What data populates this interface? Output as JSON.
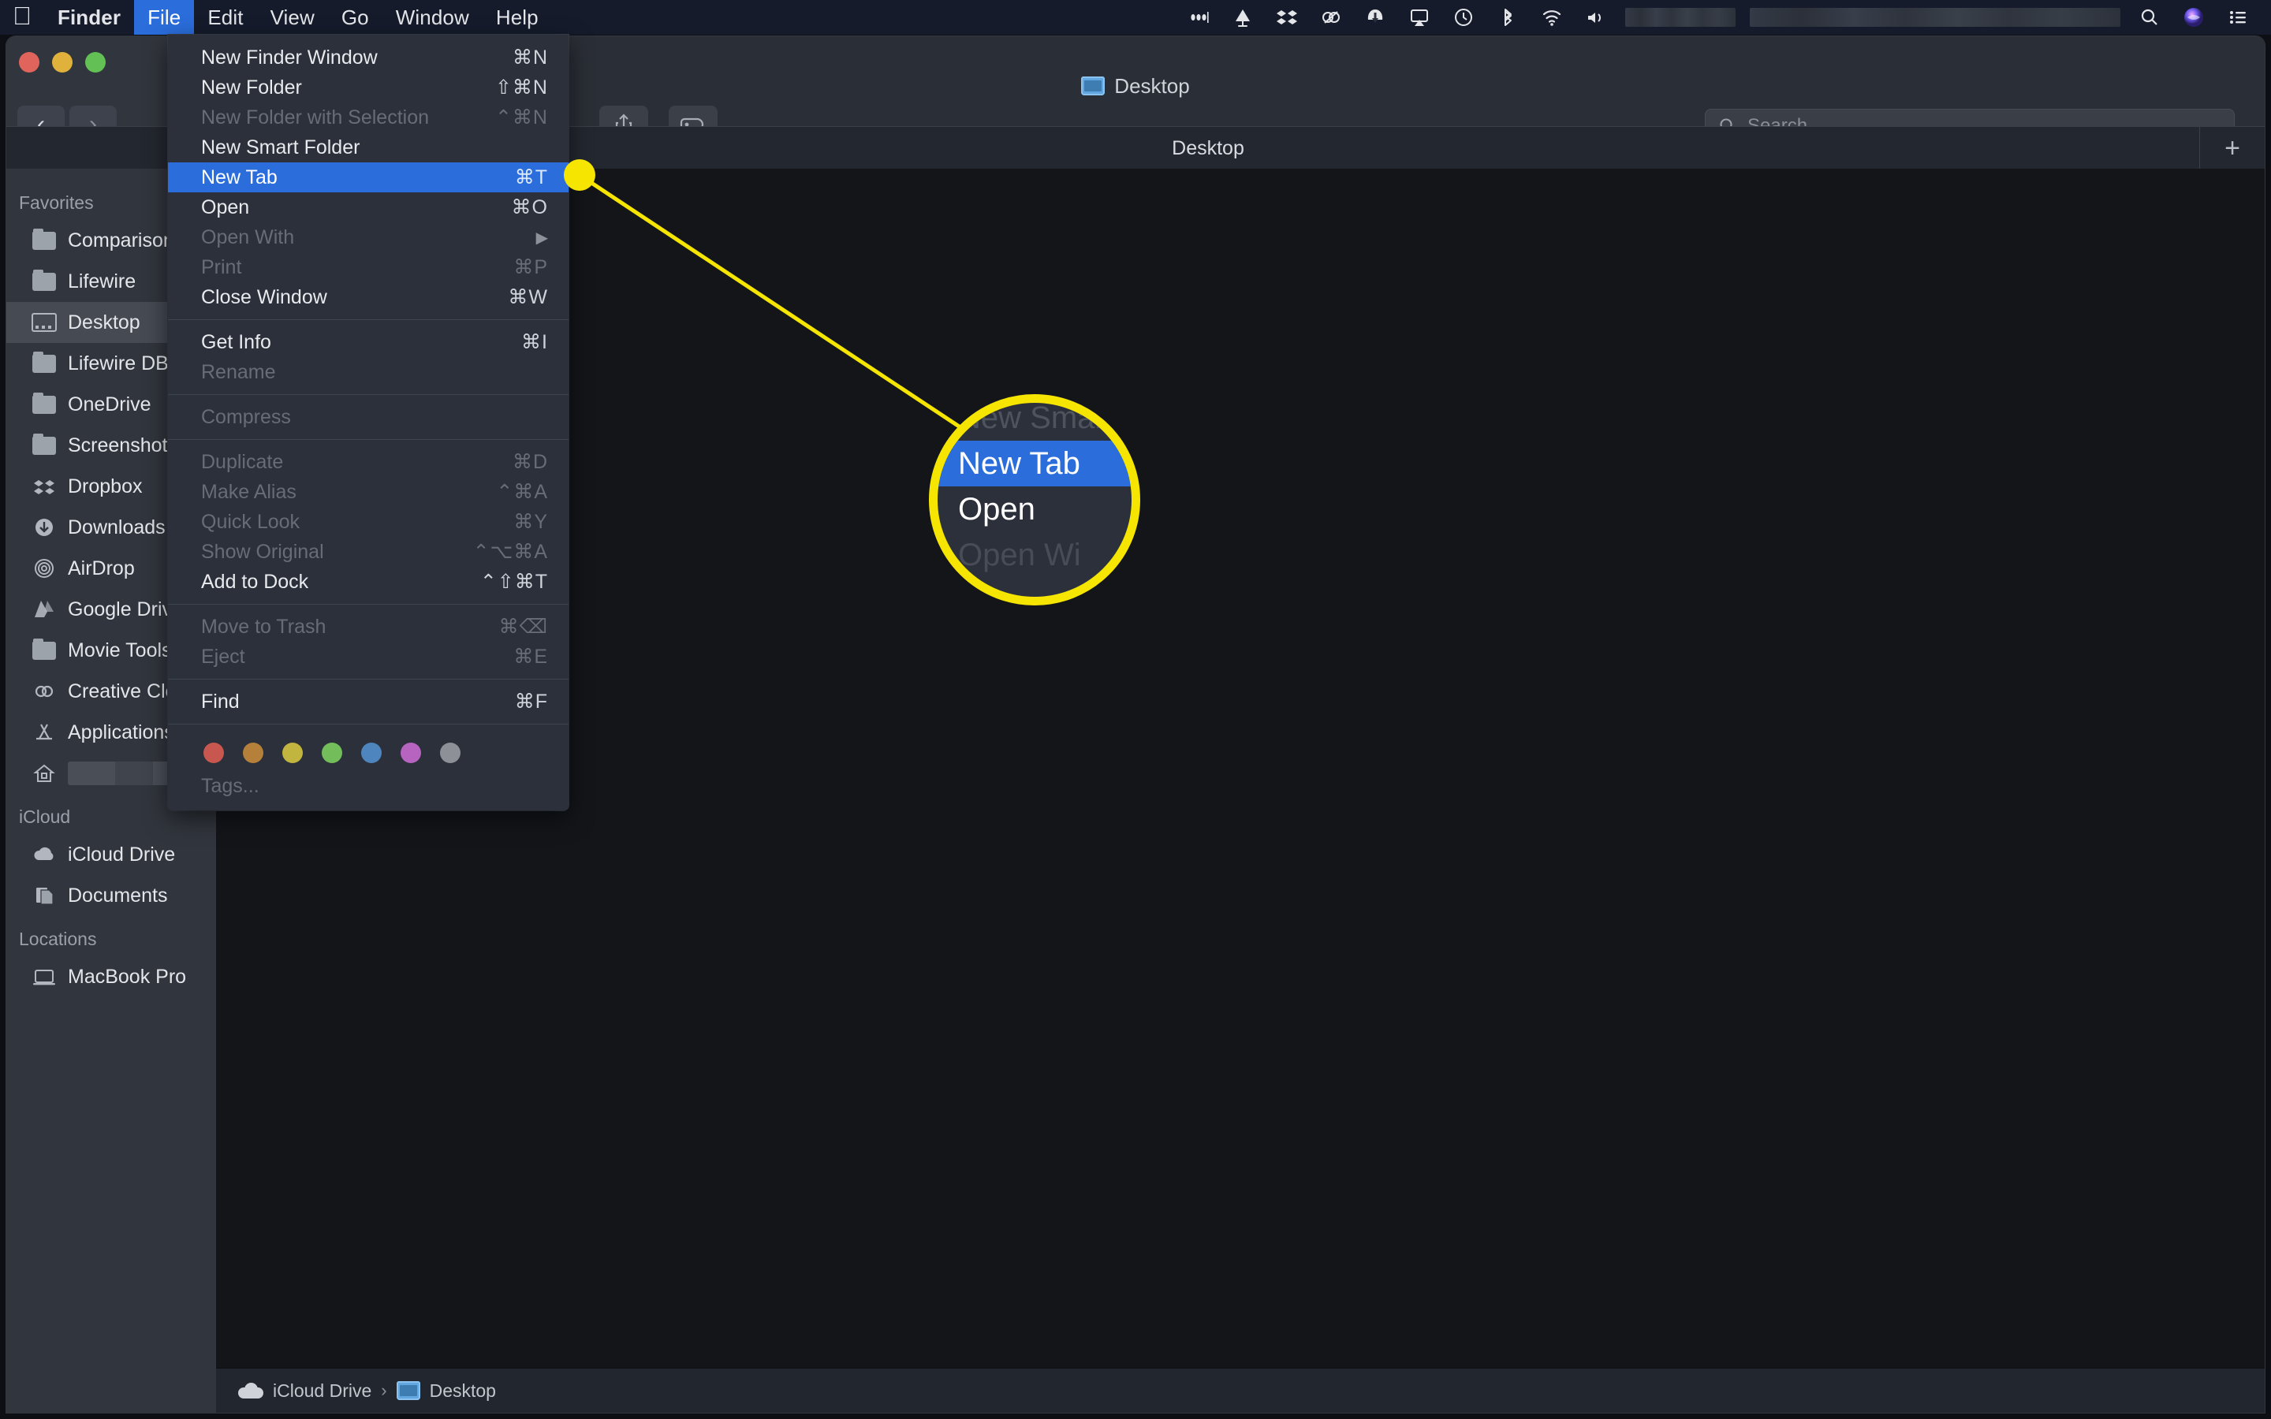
{
  "menubar": {
    "apple_icon": "apple-logo-icon",
    "items": [
      {
        "label": "Finder",
        "bold": true,
        "active": false
      },
      {
        "label": "File",
        "bold": false,
        "active": true
      },
      {
        "label": "Edit",
        "bold": false,
        "active": false
      },
      {
        "label": "View",
        "bold": false,
        "active": false
      },
      {
        "label": "Go",
        "bold": false,
        "active": false
      },
      {
        "label": "Window",
        "bold": false,
        "active": false
      },
      {
        "label": "Help",
        "bold": false,
        "active": false
      }
    ],
    "status_icons": [
      "ellipsis-icon",
      "bell-lamp-icon",
      "dropbox-icon",
      "creative-cloud-icon",
      "onedrive-cloud-icon",
      "airplay-icon",
      "time-machine-icon",
      "bluetooth-icon",
      "wifi-icon",
      "volume-icon"
    ],
    "redacted_widths": [
      140,
      470
    ],
    "trailing_icons": [
      "search-icon",
      "siri-icon",
      "control-center-icon"
    ]
  },
  "window": {
    "title": "Desktop",
    "title_folder_icon": "blue-folder-icon",
    "traffic_lights": [
      "close-button",
      "minimize-button",
      "maximize-button"
    ],
    "nav": {
      "back": "back-chevron-icon",
      "forward": "forward-chevron-icon"
    },
    "toolbar_buttons": [
      "share-icon",
      "tags-icon"
    ],
    "search": {
      "placeholder": "Search",
      "value": "",
      "icon": "search-icon"
    },
    "tab": {
      "label": "Desktop",
      "add_label": "+"
    },
    "pathbar": {
      "segments": [
        {
          "label": "iCloud Drive",
          "icon": "cloud-icon"
        },
        {
          "label": "Desktop",
          "icon": "blue-folder-icon"
        }
      ],
      "separator": "›"
    }
  },
  "sidebar": {
    "groups": [
      {
        "title": "Favorites",
        "items": [
          {
            "label": "Comparison",
            "icon": "folder-icon",
            "selected": false,
            "redacted": false
          },
          {
            "label": "Lifewire",
            "icon": "folder-icon",
            "selected": false,
            "redacted": false
          },
          {
            "label": "Desktop",
            "icon": "desktop-icon",
            "selected": true,
            "redacted": false
          },
          {
            "label": "Lifewire DB",
            "icon": "folder-icon",
            "selected": false,
            "redacted": false
          },
          {
            "label": "OneDrive",
            "icon": "folder-icon",
            "selected": false,
            "redacted": false
          },
          {
            "label": "Screenshots",
            "icon": "folder-icon",
            "selected": false,
            "redacted": false
          },
          {
            "label": "Dropbox",
            "icon": "dropbox-icon",
            "selected": false,
            "redacted": false
          },
          {
            "label": "Downloads",
            "icon": "downloads-icon",
            "selected": false,
            "redacted": false
          },
          {
            "label": "AirDrop",
            "icon": "airdrop-icon",
            "selected": false,
            "redacted": false
          },
          {
            "label": "Google Drive",
            "icon": "google-drive-icon",
            "selected": false,
            "redacted": false
          },
          {
            "label": "Movie Tools",
            "icon": "folder-icon",
            "selected": false,
            "redacted": false
          },
          {
            "label": "Creative Cloud",
            "icon": "creative-cloud-icon",
            "selected": false,
            "redacted": false
          },
          {
            "label": "Applications",
            "icon": "applications-icon",
            "selected": false,
            "redacted": false
          },
          {
            "label": "",
            "icon": "home-icon",
            "selected": false,
            "redacted": true
          }
        ]
      },
      {
        "title": "iCloud",
        "items": [
          {
            "label": "iCloud Drive",
            "icon": "cloud-icon",
            "selected": false,
            "redacted": false
          },
          {
            "label": "Documents",
            "icon": "documents-icon",
            "selected": false,
            "redacted": false
          }
        ]
      },
      {
        "title": "Locations",
        "items": [
          {
            "label": "MacBook Pro",
            "icon": "laptop-icon",
            "selected": false,
            "redacted": false
          }
        ]
      }
    ]
  },
  "file_menu": {
    "sections": [
      {
        "items": [
          {
            "label": "New Finder Window",
            "shortcut": "⌘N",
            "state": "normal"
          },
          {
            "label": "New Folder",
            "shortcut": "⇧⌘N",
            "state": "normal"
          },
          {
            "label": "New Folder with Selection",
            "shortcut": "⌃⌘N",
            "state": "disabled"
          },
          {
            "label": "New Smart Folder",
            "shortcut": "",
            "state": "normal"
          },
          {
            "label": "New Tab",
            "shortcut": "⌘T",
            "state": "highlighted"
          },
          {
            "label": "Open",
            "shortcut": "⌘O",
            "state": "normal"
          },
          {
            "label": "Open With",
            "shortcut": "▶",
            "state": "disabled",
            "submenu": true
          },
          {
            "label": "Print",
            "shortcut": "⌘P",
            "state": "disabled"
          },
          {
            "label": "Close Window",
            "shortcut": "⌘W",
            "state": "normal"
          }
        ]
      },
      {
        "items": [
          {
            "label": "Get Info",
            "shortcut": "⌘I",
            "state": "normal"
          },
          {
            "label": "Rename",
            "shortcut": "",
            "state": "disabled"
          }
        ]
      },
      {
        "items": [
          {
            "label": "Compress",
            "shortcut": "",
            "state": "disabled"
          }
        ]
      },
      {
        "items": [
          {
            "label": "Duplicate",
            "shortcut": "⌘D",
            "state": "disabled"
          },
          {
            "label": "Make Alias",
            "shortcut": "⌃⌘A",
            "state": "disabled"
          },
          {
            "label": "Quick Look",
            "shortcut": "⌘Y",
            "state": "disabled"
          },
          {
            "label": "Show Original",
            "shortcut": "⌃⌥⌘A",
            "state": "disabled"
          },
          {
            "label": "Add to Dock",
            "shortcut": "⌃⇧⌘T",
            "state": "normal"
          }
        ]
      },
      {
        "items": [
          {
            "label": "Move to Trash",
            "shortcut": "⌘⌫",
            "state": "disabled"
          },
          {
            "label": "Eject",
            "shortcut": "⌘E",
            "state": "disabled"
          }
        ]
      },
      {
        "items": [
          {
            "label": "Find",
            "shortcut": "⌘F",
            "state": "normal"
          }
        ]
      }
    ],
    "tags": {
      "colors": [
        "#c8574f",
        "#b5813a",
        "#c2b53f",
        "#74bd5b",
        "#4f85bf",
        "#b763c0",
        "#8d9197"
      ],
      "label": "Tags..."
    }
  },
  "callout": {
    "accent_color": "#f5e500",
    "dot_label": "new-tab-menu-item-pointer",
    "magnified_rows": [
      {
        "label": "New Smar",
        "state": "clipped-top"
      },
      {
        "label": "New Tab",
        "state": "highlighted"
      },
      {
        "label": "Open",
        "state": "normal"
      },
      {
        "label": "Open Wi",
        "state": "faded"
      }
    ]
  }
}
